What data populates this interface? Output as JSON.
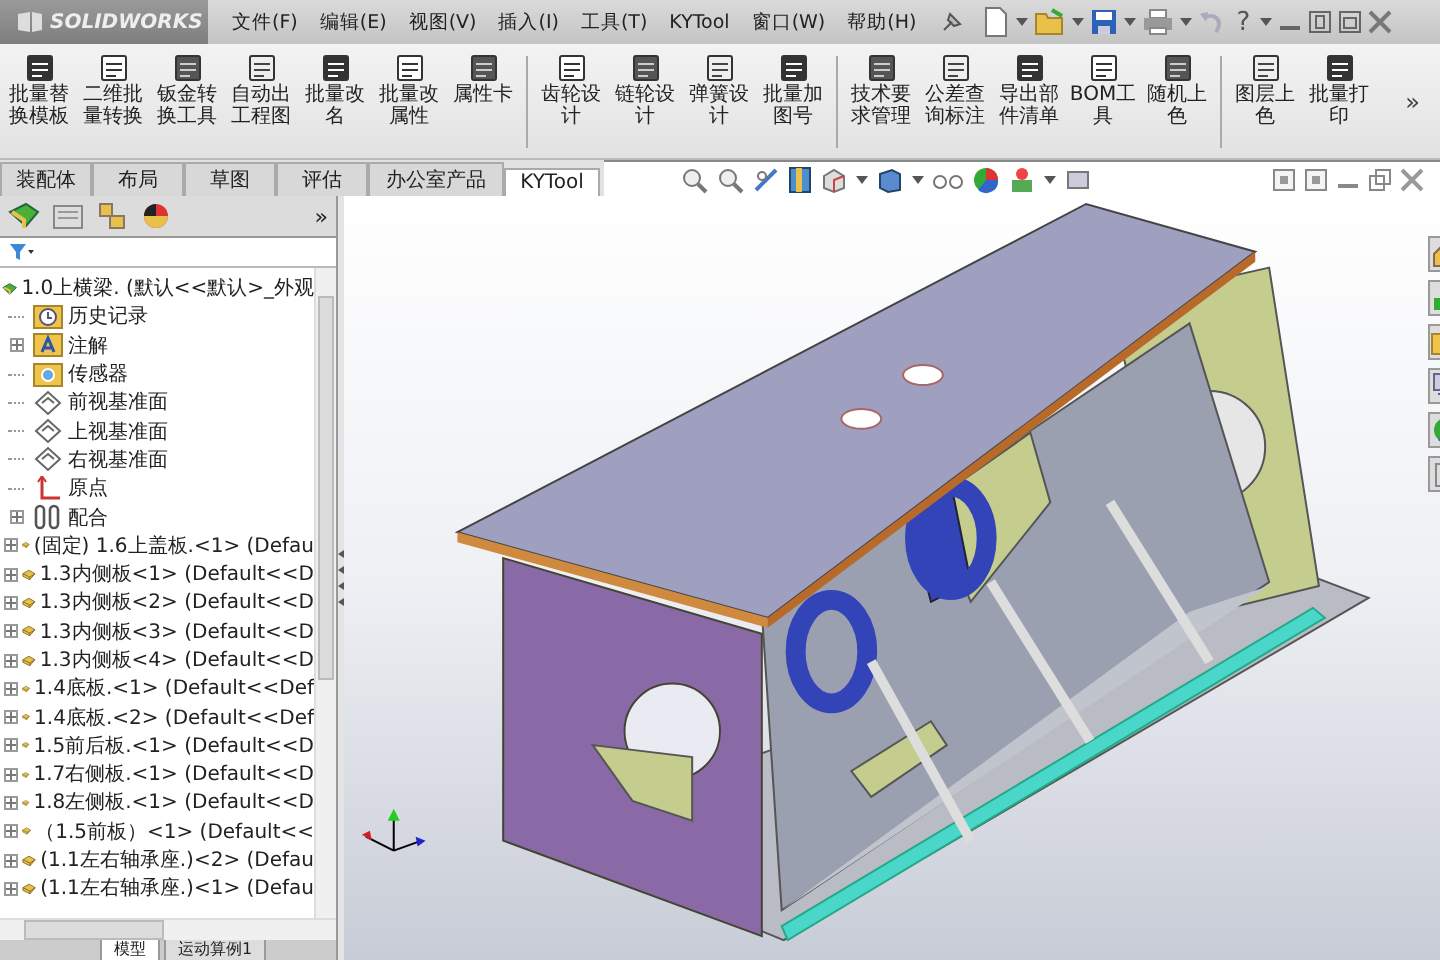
{
  "app": {
    "logo": "SOLIDWORKS"
  },
  "menu": [
    {
      "label": "文件(F)"
    },
    {
      "label": "编辑(E)"
    },
    {
      "label": "视图(V)"
    },
    {
      "label": "插入(I)"
    },
    {
      "label": "工具(T)"
    },
    {
      "label": "KYTool"
    },
    {
      "label": "窗口(W)"
    },
    {
      "label": "帮助(H)"
    }
  ],
  "quick_access": {
    "help": "?"
  },
  "ribbon": {
    "groups": [
      [
        {
          "label": "批量替换模板"
        },
        {
          "label": "二维批量转换"
        },
        {
          "label": "钣金转换工具"
        },
        {
          "label": "自动出工程图"
        },
        {
          "label": "批量改名"
        },
        {
          "label": "批量改属性"
        },
        {
          "label": "属性卡"
        }
      ],
      [
        {
          "label": "齿轮设计"
        },
        {
          "label": "链轮设计"
        },
        {
          "label": "弹簧设计"
        },
        {
          "label": "批量加图号"
        }
      ],
      [
        {
          "label": "技术要求管理"
        },
        {
          "label": "公差查询标注"
        },
        {
          "label": "导出部件清单"
        },
        {
          "label": "BOM工具"
        },
        {
          "label": "随机上色"
        }
      ],
      [
        {
          "label": "图层上色"
        },
        {
          "label": "批量打印"
        }
      ]
    ],
    "more": "»"
  },
  "tabs": [
    {
      "label": "装配体",
      "selected": false
    },
    {
      "label": "布局",
      "selected": false
    },
    {
      "label": "草图",
      "selected": false
    },
    {
      "label": "评估",
      "selected": false
    },
    {
      "label": "办公室产品",
      "selected": false
    },
    {
      "label": "KYTool",
      "selected": true
    }
  ],
  "feature_tree": {
    "more": "»",
    "root": "1.0上横梁. (默认<<默认>_外观",
    "items": [
      {
        "kind": "history",
        "label": "历史记录",
        "collapsed": false
      },
      {
        "kind": "annotation",
        "label": "注解",
        "collapsed": true
      },
      {
        "kind": "sensor",
        "label": "传感器",
        "collapsed": false
      },
      {
        "kind": "plane",
        "label": "前视基准面",
        "collapsed": false
      },
      {
        "kind": "plane",
        "label": "上视基准面",
        "collapsed": false
      },
      {
        "kind": "plane",
        "label": "右视基准面",
        "collapsed": false
      },
      {
        "kind": "origin",
        "label": "原点",
        "collapsed": false
      },
      {
        "kind": "mate",
        "label": "配合",
        "collapsed": true
      },
      {
        "kind": "part",
        "label": "(固定) 1.6上盖板.<1> (Defau",
        "collapsed": true
      },
      {
        "kind": "part",
        "label": "1.3内侧板<1> (Default<<D",
        "collapsed": true
      },
      {
        "kind": "part",
        "label": "1.3内侧板<2> (Default<<D",
        "collapsed": true
      },
      {
        "kind": "part",
        "label": "1.3内侧板<3> (Default<<D",
        "collapsed": true
      },
      {
        "kind": "part",
        "label": "1.3内侧板<4> (Default<<D",
        "collapsed": true
      },
      {
        "kind": "part",
        "label": "1.4底板.<1> (Default<<Def",
        "collapsed": true
      },
      {
        "kind": "part",
        "label": "1.4底板.<2> (Default<<Def",
        "collapsed": true
      },
      {
        "kind": "part",
        "label": "1.5前后板.<1> (Default<<D",
        "collapsed": true
      },
      {
        "kind": "part",
        "label": "1.7右侧板.<1> (Default<<D",
        "collapsed": true
      },
      {
        "kind": "part",
        "label": "1.8左侧板.<1> (Default<<D",
        "collapsed": true
      },
      {
        "kind": "part",
        "label": "（1.5前板）<1> (Default<<",
        "collapsed": true
      },
      {
        "kind": "part",
        "label": "(1.1左右轴承座.)<2> (Defau",
        "collapsed": true
      },
      {
        "kind": "part",
        "label": "(1.1左右轴承座.)<1> (Defau",
        "collapsed": true
      }
    ]
  },
  "bottom_tabs": [
    {
      "label": "模型",
      "selected": true
    },
    {
      "label": "运动算例1",
      "selected": false
    }
  ]
}
